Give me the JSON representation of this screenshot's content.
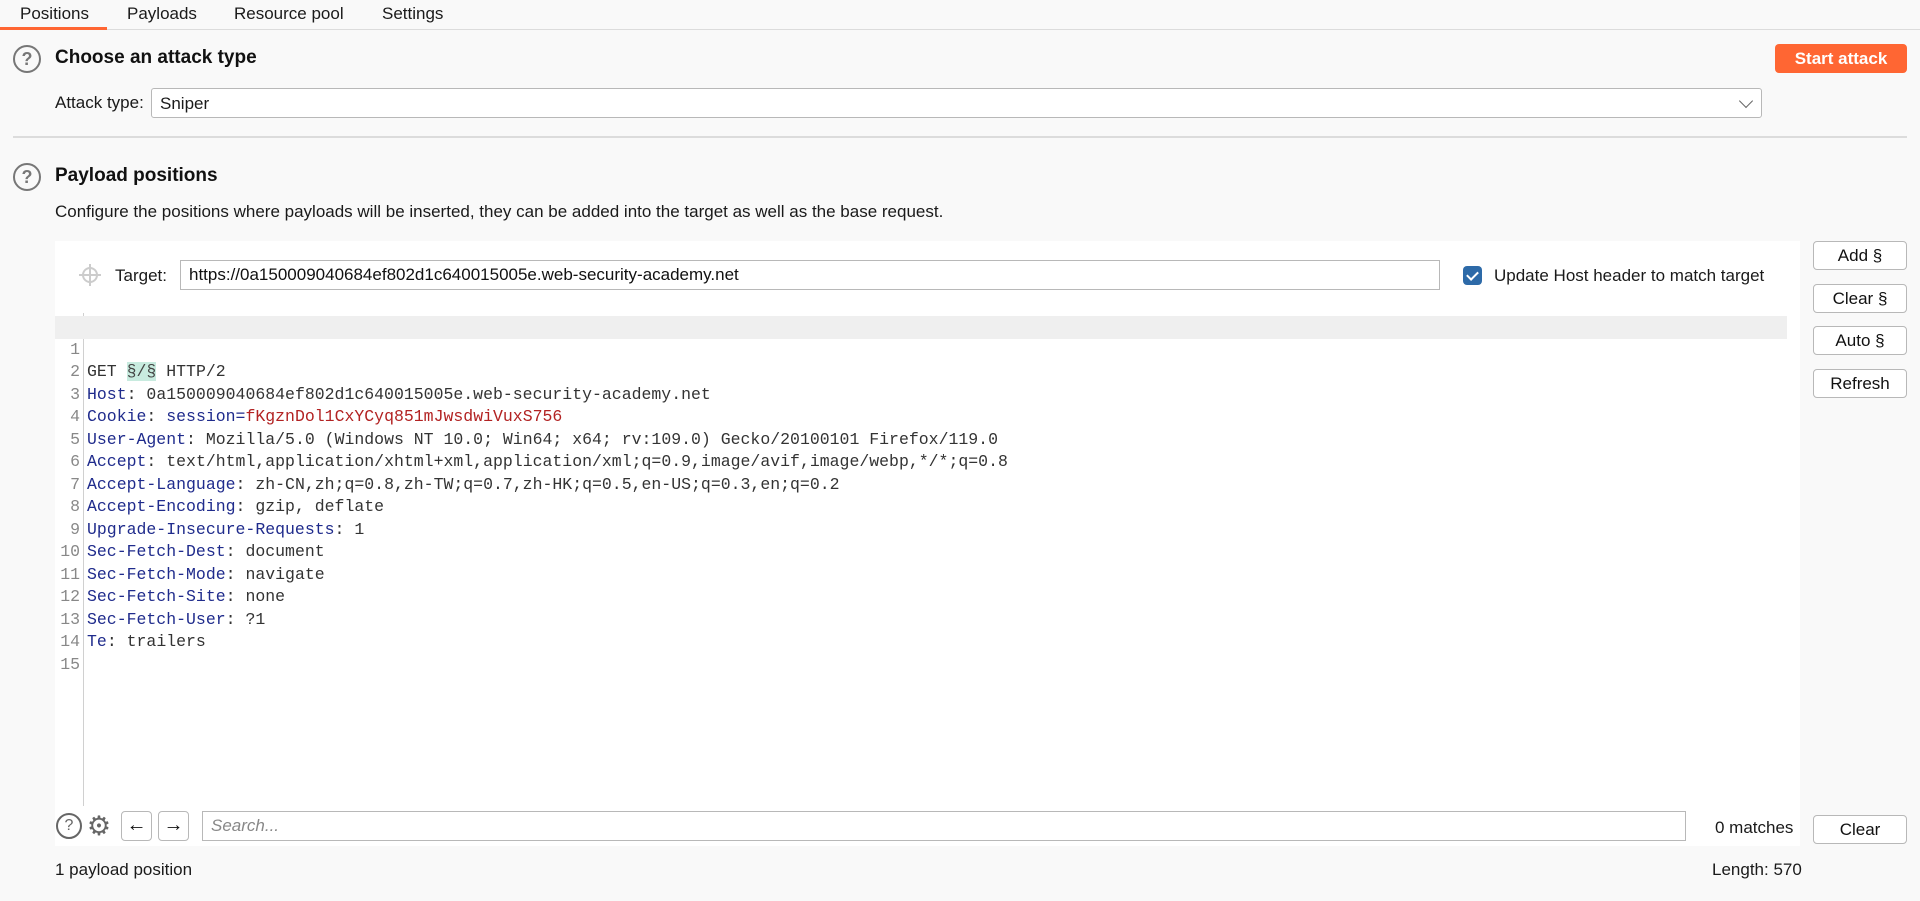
{
  "tabs": [
    {
      "label": "Positions",
      "active": true
    },
    {
      "label": "Payloads",
      "active": false
    },
    {
      "label": "Resource pool",
      "active": false
    },
    {
      "label": "Settings",
      "active": false
    }
  ],
  "colors": {
    "accent": "#ff6633",
    "checkbox": "#2d6aa8",
    "marker_bg": "#c8ebdf",
    "header_key": "#1f2b8c",
    "cookie_value": "#b22222"
  },
  "attack_section": {
    "title": "Choose an attack type",
    "attack_type_label": "Attack type:",
    "attack_type_value": "Sniper",
    "start_attack_label": "Start attack"
  },
  "positions_section": {
    "title": "Payload positions",
    "description": "Configure the positions where payloads will be inserted, they can be added into the target as well as the base request.",
    "target_label": "Target:",
    "target_value": "https://0a150009040684ef802d1c640015005e.web-security-academy.net",
    "update_host_checked": true,
    "update_host_label": "Update Host header to match target"
  },
  "side_buttons": {
    "add": "Add §",
    "clear": "Clear §",
    "auto": "Auto §",
    "refresh": "Refresh"
  },
  "request": {
    "line1": {
      "method": "GET",
      "marker": "§/§",
      "version": "HTTP/2"
    },
    "headers": [
      {
        "name": "Host",
        "value": "0a150009040684ef802d1c640015005e.web-security-academy.net"
      },
      {
        "name": "Cookie",
        "cookie_name": "session",
        "value": "fKgznDol1CxYCyq851mJwsdwiVuxS756"
      },
      {
        "name": "User-Agent",
        "value": "Mozilla/5.0 (Windows NT 10.0; Win64; x64; rv:109.0) Gecko/20100101 Firefox/119.0"
      },
      {
        "name": "Accept",
        "value": "text/html,application/xhtml+xml,application/xml;q=0.9,image/avif,image/webp,*/*;q=0.8"
      },
      {
        "name": "Accept-Language",
        "value": "zh-CN,zh;q=0.8,zh-TW;q=0.7,zh-HK;q=0.5,en-US;q=0.3,en;q=0.2"
      },
      {
        "name": "Accept-Encoding",
        "value": "gzip, deflate"
      },
      {
        "name": "Upgrade-Insecure-Requests",
        "value": "1"
      },
      {
        "name": "Sec-Fetch-Dest",
        "value": "document"
      },
      {
        "name": "Sec-Fetch-Mode",
        "value": "navigate"
      },
      {
        "name": "Sec-Fetch-Site",
        "value": "none"
      },
      {
        "name": "Sec-Fetch-User",
        "value": "?1"
      },
      {
        "name": "Te",
        "value": "trailers"
      }
    ],
    "line_numbers": [
      "1",
      "2",
      "3",
      "4",
      "5",
      "6",
      "7",
      "8",
      "9",
      "10",
      "11",
      "12",
      "13",
      "14",
      "15"
    ]
  },
  "search": {
    "placeholder": "Search...",
    "value": "",
    "matches": "0 matches",
    "clear_label": "Clear"
  },
  "footer": {
    "payload_count": "1 payload position",
    "length": "Length: 570"
  },
  "icons": {
    "help": "?",
    "gear": "⚙",
    "prev": "←",
    "next": "→"
  }
}
